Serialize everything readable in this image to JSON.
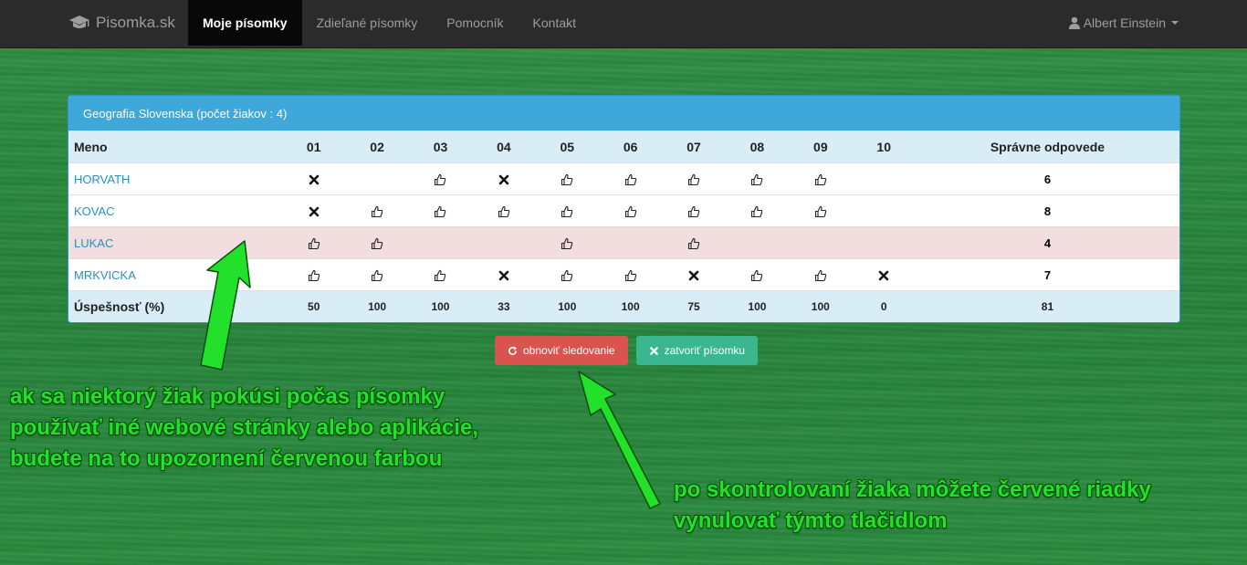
{
  "navbar": {
    "brand": "Pisomka.sk",
    "brand_icon": "graduation-cap-icon",
    "items": [
      {
        "label": "Moje písomky",
        "active": true
      },
      {
        "label": "Zdieľané písomky",
        "active": false
      },
      {
        "label": "Pomocník",
        "active": false
      },
      {
        "label": "Kontakt",
        "active": false
      }
    ],
    "user": "Albert Einstein",
    "user_icon": "user-icon"
  },
  "panel": {
    "title": "Geografia Slovenska (počet žiakov : 4)",
    "header": {
      "name": "Meno",
      "questions": [
        "01",
        "02",
        "03",
        "04",
        "05",
        "06",
        "07",
        "08",
        "09",
        "10"
      ],
      "correct": "Správne odpovede"
    },
    "students": [
      {
        "name": "HORVATH",
        "flagged": false,
        "answers": [
          "wrong",
          "",
          "correct",
          "wrong",
          "correct",
          "correct",
          "correct",
          "correct",
          "correct",
          ""
        ],
        "correct": "6"
      },
      {
        "name": "KOVAC",
        "flagged": false,
        "answers": [
          "wrong",
          "correct",
          "correct",
          "correct",
          "correct",
          "correct",
          "correct",
          "correct",
          "correct",
          ""
        ],
        "correct": "8"
      },
      {
        "name": "LUKAC",
        "flagged": true,
        "answers": [
          "correct",
          "correct",
          "",
          "",
          "correct",
          "",
          "correct",
          "",
          "",
          ""
        ],
        "correct": "4"
      },
      {
        "name": "MRKVICKA",
        "flagged": false,
        "answers": [
          "correct",
          "correct",
          "correct",
          "wrong",
          "correct",
          "correct",
          "wrong",
          "correct",
          "correct",
          "wrong"
        ],
        "correct": "7"
      }
    ],
    "footer": {
      "label": "Úspešnosť (%)",
      "values": [
        "50",
        "100",
        "100",
        "33",
        "100",
        "100",
        "75",
        "100",
        "100",
        "0"
      ],
      "total": "81"
    }
  },
  "buttons": {
    "refresh": "obnoviť sledovanie",
    "refresh_icon": "refresh-icon",
    "close": "zatvoriť písomku",
    "close_icon": "close-icon"
  },
  "annotations": {
    "note1": [
      "ak sa niektorý žiak pokúsi počas písomky",
      "používať iné webové stránky alebo aplikácie,",
      "budete na to upozornení červenou farbou"
    ],
    "note2": [
      "po skontrolovaní žiaka môžete červené riadky",
      "vynulovať týmto tlačidlom"
    ]
  },
  "colors": {
    "navbar": "#2b2b2b",
    "panel_heading": "#3ea8da",
    "flagged_row": "#f2dede",
    "refresh_button": "#d9534f",
    "close_button": "#3bb78f",
    "annotation_text": "#23e02a"
  }
}
